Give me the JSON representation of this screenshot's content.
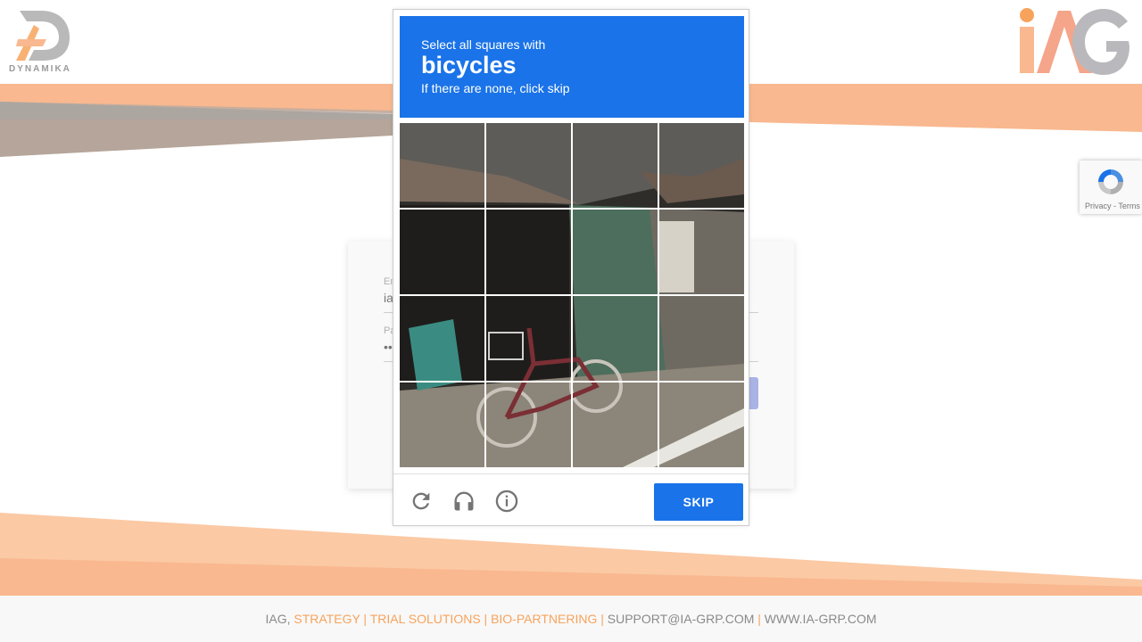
{
  "brand": {
    "left_logo_text": "DYNAMIKA",
    "accent_color": "#f7a35c",
    "band_color": "#f9b88f"
  },
  "login": {
    "email_label": "Em",
    "email_value": "ia",
    "password_label": "Pa",
    "password_value": "••"
  },
  "captcha": {
    "line1": "Select all squares with",
    "keyword": "bicycles",
    "line3": "If there are none, click skip",
    "skip_label": "SKIP",
    "header_color": "#1a73e8",
    "icons": [
      "reload-icon",
      "audio-headphones-icon",
      "info-icon"
    ]
  },
  "recaptcha_badge": {
    "text": "Privacy - Terms"
  },
  "footer": {
    "prefix": "IAG,",
    "links": "STRATEGY | TRIAL SOLUTIONS | BIO-PARTNERING |",
    "email": "SUPPORT@IA-GRP.COM",
    "sep": "|",
    "website": "WWW.IA-GRP.COM"
  }
}
